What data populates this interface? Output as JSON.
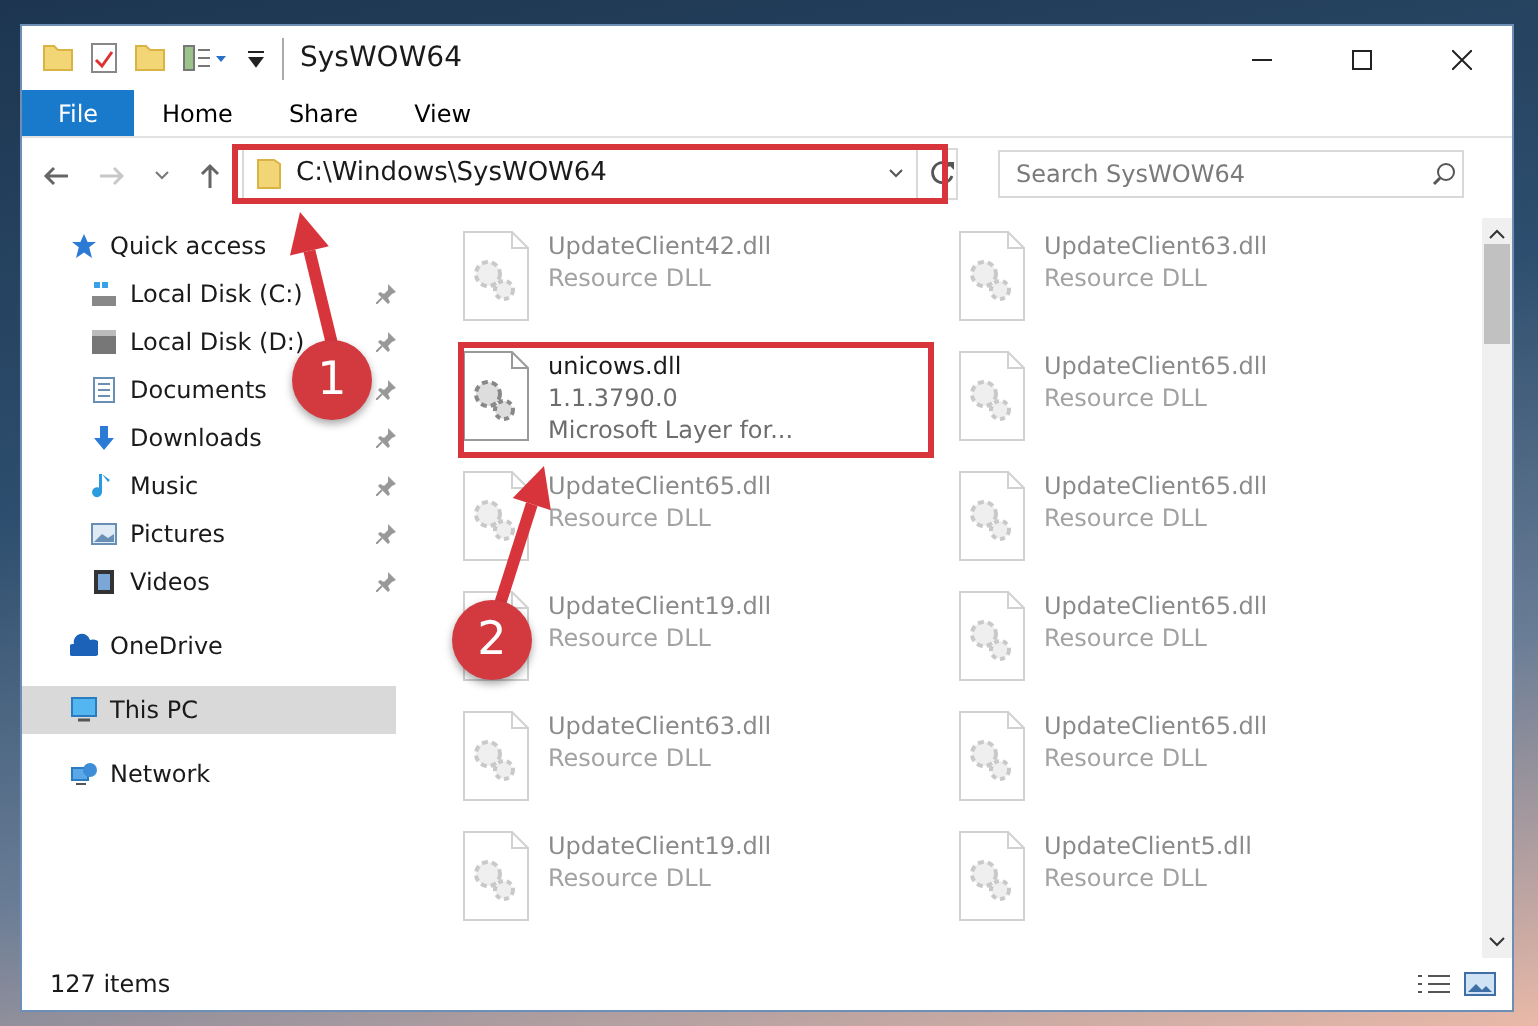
{
  "window": {
    "title": "SysWOW64"
  },
  "ribbon": {
    "file_tab": "File",
    "tabs": [
      "Home",
      "Share",
      "View"
    ]
  },
  "address": {
    "path": "C:\\Windows\\SysWOW64"
  },
  "search": {
    "placeholder": "Search SysWOW64"
  },
  "sidebar": [
    {
      "label": "Quick access",
      "kind": "star",
      "selected": false,
      "children": [
        {
          "label": "Local Disk (C:)",
          "kind": "drive-c",
          "pinned": true
        },
        {
          "label": "Local Disk (D:)",
          "kind": "drive",
          "pinned": true
        },
        {
          "label": "Documents",
          "kind": "documents",
          "pinned": true
        },
        {
          "label": "Downloads",
          "kind": "downloads",
          "pinned": true
        },
        {
          "label": "Music",
          "kind": "music",
          "pinned": true
        },
        {
          "label": "Pictures",
          "kind": "pictures",
          "pinned": true
        },
        {
          "label": "Videos",
          "kind": "videos",
          "pinned": true
        }
      ]
    },
    {
      "label": "OneDrive",
      "kind": "cloud",
      "selected": false
    },
    {
      "label": "This PC",
      "kind": "pc",
      "selected": true
    },
    {
      "label": "Network",
      "kind": "network",
      "selected": false
    }
  ],
  "files": [
    {
      "name": "UpdateClient42.dll",
      "lines": [
        "Resource DLL"
      ],
      "dimmed": true
    },
    {
      "name": "UpdateClient63.dll",
      "lines": [
        "Resource DLL"
      ],
      "dimmed": true
    },
    {
      "name": "unicows.dll",
      "lines": [
        "1.1.3790.0",
        "Microsoft Layer for..."
      ],
      "dimmed": false
    },
    {
      "name": "UpdateClient65.dll",
      "lines": [
        "Resource DLL"
      ],
      "dimmed": true
    },
    {
      "name": "UpdateClient65.dll",
      "lines": [
        "Resource DLL"
      ],
      "dimmed": true
    },
    {
      "name": "UpdateClient65.dll",
      "lines": [
        "Resource DLL"
      ],
      "dimmed": true
    },
    {
      "name": "UpdateClient19.dll",
      "lines": [
        "Resource DLL"
      ],
      "dimmed": true
    },
    {
      "name": "UpdateClient65.dll",
      "lines": [
        "Resource DLL"
      ],
      "dimmed": true
    },
    {
      "name": "UpdateClient63.dll",
      "lines": [
        "Resource DLL"
      ],
      "dimmed": true
    },
    {
      "name": "UpdateClient65.dll",
      "lines": [
        "Resource DLL"
      ],
      "dimmed": true
    },
    {
      "name": "UpdateClient19.dll",
      "lines": [
        "Resource DLL"
      ],
      "dimmed": true
    },
    {
      "name": "UpdateClient5.dll",
      "lines": [
        "Resource DLL"
      ],
      "dimmed": true
    }
  ],
  "status_bar": {
    "count": "127 items"
  },
  "callouts": [
    {
      "number": "1"
    },
    {
      "number": "2"
    }
  ]
}
